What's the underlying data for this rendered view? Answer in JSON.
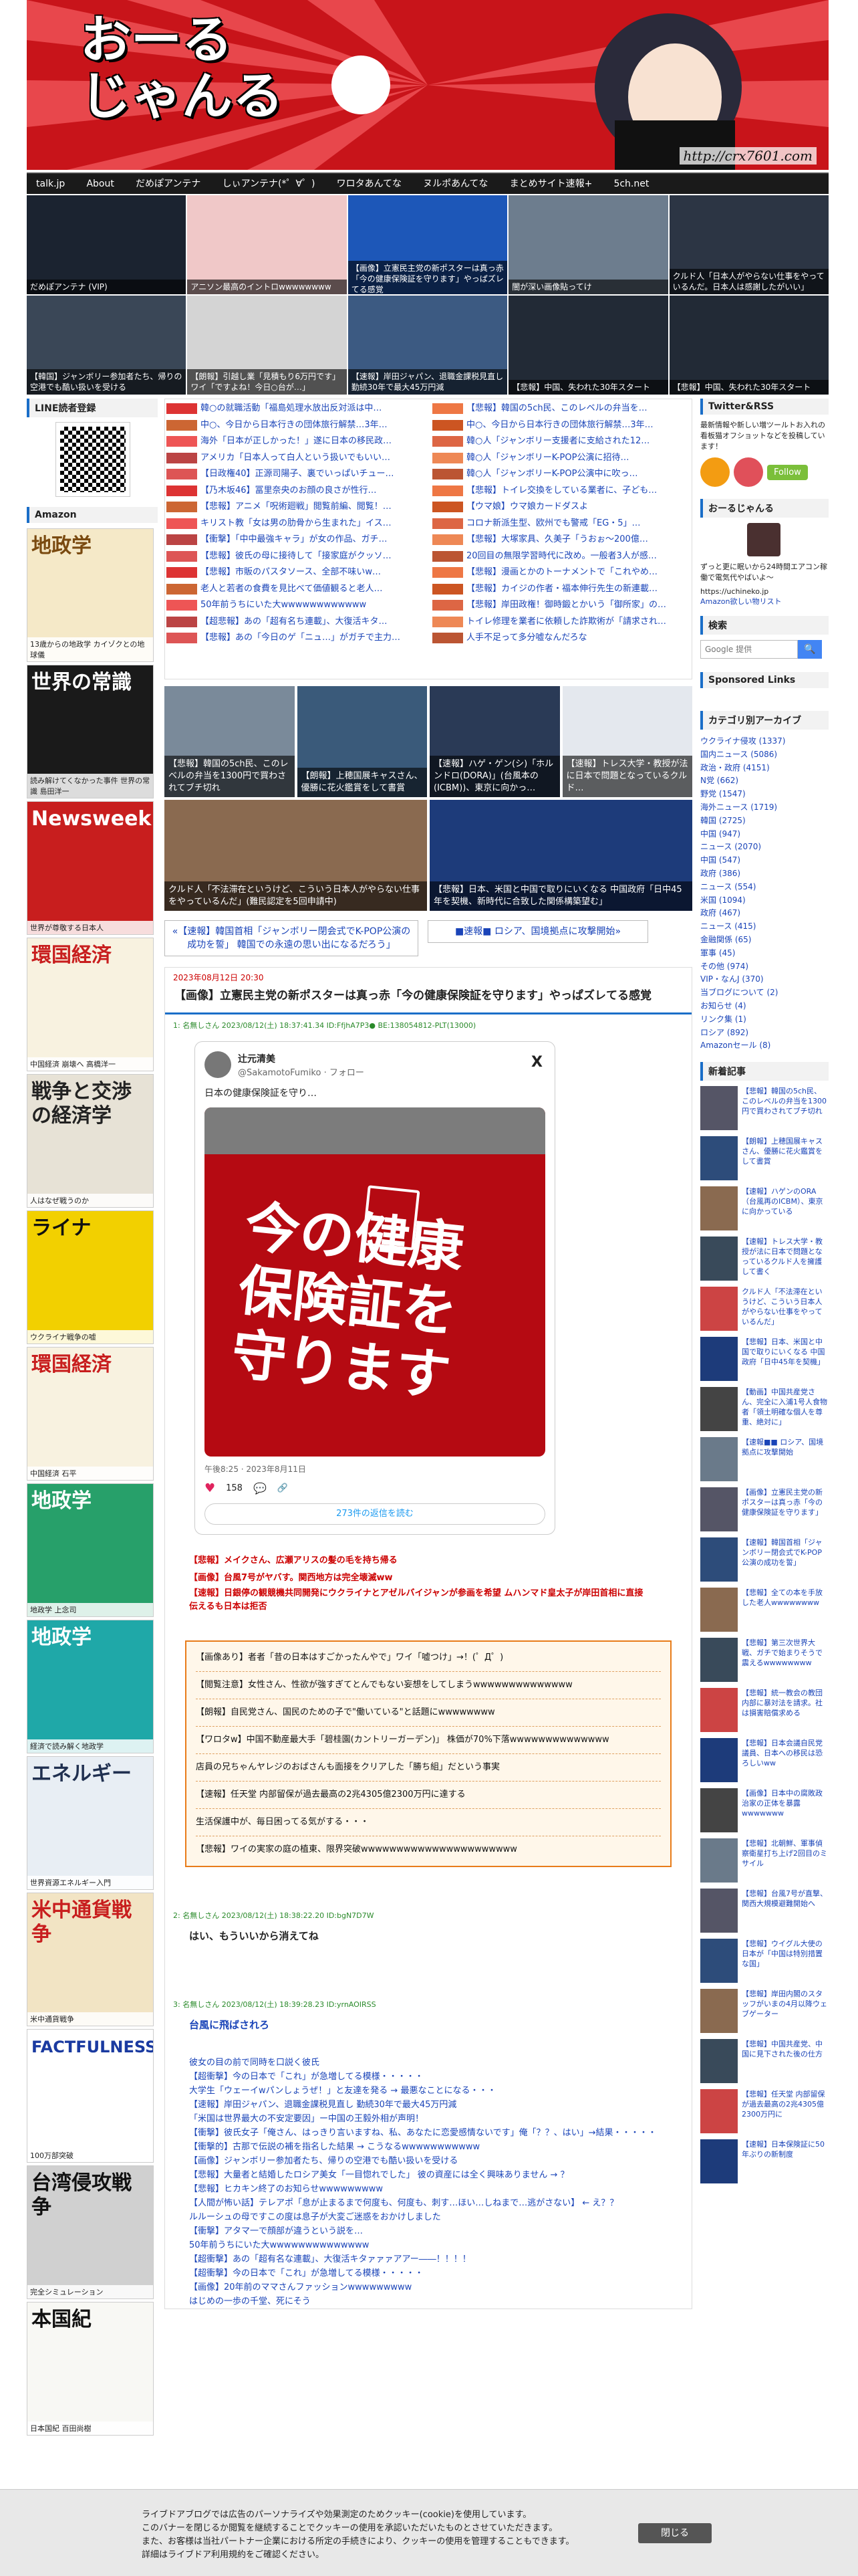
{
  "site": {
    "logo_lines": [
      "おーる",
      "じゃんる"
    ],
    "url": "http://crx7601.com",
    "marker": "0"
  },
  "nav": [
    "talk.jp",
    "About",
    "だめぽアンテナ",
    "しぃアンテナ(*゜∀゜)",
    "ワロタあんてな",
    "ヌルポあんてな",
    "まとめサイト速報+",
    "5ch.net"
  ],
  "strip": [
    "だめぽアンテナ (VIP)",
    "アニソン最高のイントロwwwwwwww",
    "【画像】立憲民主党の新ポスターは真っ赤「今の健康保険証を守ります」やっぱズレてる感覚",
    "闇が深い画像貼ってけ",
    "クルド人「日本人がやらない仕事をやっているんだ。日本人は感謝したがいい」",
    "【韓国】ジャンボリー参加者たち、帰りの空港でも酷い扱いを受ける",
    "【朗報】引越し業「見積もり6万円です」ワイ「ですよね！今日○台が…」",
    "【速報】岸田ジャパン、退職金課税見直し 勤続30年で最大45万円減",
    "【悲報】中国、失われた30年スタート",
    "【悲報】中国、失われた30年スタート"
  ],
  "left": {
    "line_heading": "LINE読者登録",
    "amazon_heading": "Amazon",
    "books": [
      {
        "title": "地政学",
        "caption": "13歳からの地政学 カイゾクとの地球儀"
      },
      {
        "title": "世界の常識",
        "caption": "読み解けてくなかった事件 世界の常識 島田洋一"
      },
      {
        "title": "Newsweek",
        "caption": "世界が尊敬する日本人"
      },
      {
        "title": "環国経済",
        "caption": "中国経済 崩壊へ 高橋洋一"
      },
      {
        "title": "戦争と交渉の経済学",
        "caption": "人はなぜ戦うのか"
      },
      {
        "title": "ライナ",
        "caption": "ウクライナ戦争の嘘"
      },
      {
        "title": "環国経済",
        "caption": "中国経済 石平"
      },
      {
        "title": "地政学",
        "caption": "地政学 上念司"
      },
      {
        "title": "地政学",
        "caption": "経済で読み解く地政学"
      },
      {
        "title": "エネルギー",
        "caption": "世界資源エネルギー入門"
      },
      {
        "title": "米中通貨戦争",
        "caption": "米中通貨戦争"
      },
      {
        "title": "FACTFULNESS",
        "caption": "100万部突破"
      },
      {
        "title": "台湾侵攻戦争",
        "caption": "完全シミュレーション"
      },
      {
        "title": "本国紀",
        "caption": "日本国紀 百田尚樹"
      }
    ]
  },
  "headlines": {
    "left": [
      "韓○の就職活動「福島処理水放出反対派は中…",
      "中○、今日から日本行きの団体旅行解禁…3年…",
      "海外「日本が正しかった！」遂に日本の移民政…",
      "アメリカ「日本人って白人という扱いでもいい…",
      "【日政権40】正源司陽子、裏でいっぱいチュー…",
      "【乃木坂46】冨里奈央のお顔の良さが性行…",
      "【悲報】アニメ「呪術廻戦」閲覧前編、閲覧！…",
      "キリスト教「女は男の肋骨から生まれた」イス…",
      "【衝撃】「中中最強キャラ」が女の作品、ガチ…",
      "【悲報】彼氏の母に接待して「接家庭がクッソ…",
      "【悲報】市販のパスタソース、全部不味いw…",
      "老人と若者の食費を見比べて価値観ると老人…",
      "50年前うちにいた大wwwwwwwwwwww",
      "【超悲報】あの「超有名ち連載」、大復活キタ…",
      "【悲報】あの「今日のゲ「ニュ…」がガチで主力…"
    ],
    "right": [
      "【悲報】韓国の5ch民、このレベルの弁当を…",
      "中○、今日から日本行きの団体旅行解禁…3年…",
      "韓○人「ジャンボリー支援者に支給された12…",
      "韓○人「ジャンボリーK-POP公演に招待…",
      "韓○人「ジャンボリーK-POP公演中に吹っ…",
      "【悲報】トイレ交換をしている業者に、子ども…",
      "【ウマ娘】ウマ娘カードダスよ",
      "コロナ新派生型、欧州でも警戒「EG・5」…",
      "【悲報】大塚家具、久美子「うおぉ～200億…",
      "20回目の無限学習時代に改め。一般者3人が感…",
      "【悲報】漫画とかのトーナメントで「これやめ…",
      "【悲報】カイジの作者・福本伸行先生の新連載…",
      "【悲報】岸田政権！御時鍛とかいう「御所家」の…",
      "トイレ修理を業者に依頼した詐欺術が「請求され…",
      "人手不足って多分嘘なんだろな"
    ]
  },
  "featured": [
    "【悲報】韓国の5ch民、このレベルの弁当を1300円で買わされてブチ切れ",
    "【朗報】上穂国展キャスさん、優勝に花火鑑賞をして書賞",
    "【速報】ハゲ・ゲン(シ)「ホルンドロ(DORA)」(台風本の(ICBM))、東京に向かっ…",
    "【速報】トレス大学・教授が法に日本で問題となっているクルド…",
    "クルド人「不法滞在というけど、こういう日本人がやらない仕事をやっているんだ」(難民認定を5回申請中)",
    "【悲報】日本、米国と中国で取りにいくなる 中国政府「日中45年を契機、新時代に合致した関係構築望む」"
  ],
  "prev_next": {
    "prev": "«【速報】韓国首相「ジャンボリー閉会式でK-POP公演の成功を誓」 韓国での永遠の思い出になるだろう」",
    "next": "■速報■ ロシア、国境拠点に攻撃開始»"
  },
  "article": {
    "date": "2023年08月12日 20:30",
    "title": "【画像】立憲民主党の新ポスターは真っ赤「今の健康保険証を守ります」やっぱズレてる感覚",
    "res1_head": "1: 名無しさん 2023/08/12(土) 18:37:41.34 ID:FfjhA7P3●  BE:138054812-PLT(13000)",
    "tweet": {
      "name": "辻元清美",
      "handle": "@SakamotoFumiko · フォロー",
      "text": "日本の健康保険証を守り…",
      "poster": "今の健康保険証を守ります",
      "date": "午後8:25 · 2023年8月11日",
      "likes": "158",
      "replies": "273件の返信を読む",
      "x_logo": "X"
    },
    "red_links": [
      "【悲報】メイクさん、広瀬アリスの髪の毛を持ち帰る",
      "【画像】台風7号がヤバす。関西地方は完全壊滅ww",
      "【速報】日銀停の観競機共同開発にウクライナとアゼルバイジャンが参画を希望 ムハンマド皇太子が岸田首相に直接伝えるも日本は拒否"
    ],
    "box": [
      "【画像あり】者者「昔の日本はすごかったんやで」ワイ「嘘つけ」→！(゜Д゜)",
      "【閲覧注意】女性さん、性欲が強すぎてとんでもない妄想をしてしまうwwwwwwwwwwwwww",
      "【朗報】自民党さん、国民のための子で\"働いている\"と話題にwwwwwwww",
      "【ワロタw】中国不動産最大手「碧桂園(カントリーガーデン)」 株価が70%下落wwwwwwwwwwwwww",
      "店員の兄ちゃんヤレジのおばさんも面接をクリアした「勝ち組」だという事実",
      "【速報】任天堂 内部留保が過去最高の2兆4305億2300万円に達する",
      "生活保護中が、毎日困ってる気がする・・・",
      "【悲報】ワイの実家の庭の植東、限界突破wwwwwwwwwwwwwwwwwwwwww"
    ],
    "res2_head": "2: 名無しさん 2023/08/12(土) 18:38:22.20 ID:bgN7D7W",
    "res2": "はい、もういいから消えてね",
    "res3_head": "3: 名無しさん 2023/08/12(土) 18:39:28.23 ID:yrnAOIRSS",
    "res3": "台風に飛ばされろ",
    "body_links": [
      "彼女の目の前で同時を口説く彼氏",
      "【超衝撃】今の日本で「これ」が急増してる模様・・・・・",
      "大学生「ウェーイwパンしょうぜ！」と友達を発る → 最悪なことになる・・・",
      "【速報】岸田ジャパン、退職金課税見直し 勤続30年で最大45万円減",
      "「米国は世界最大の不安定要因」ー中国の王毅外相が声明！",
      "【衝撃】彼氏女子「俺さん、はっきり言いますね、私、あなたに恋愛感情ないです」俺「？？、はい」→結果・・・・・",
      "【衝撃的】古那で伝説の補を指名した結果 → こうなるwwwwwwwwwww",
      "【画像】ジャンボリー参加者たち、帰りの空港でも酷い扱いを受ける",
      "【悲報】大量者と結婚したロシア美女「一目惚れでした」 彼の資産には全く興味ありません → ？",
      "【悲報】ヒカキン終了のお知らせwwwwwwwww",
      "【人間が怖い話】テレアポ「息が止まるまで何度も、何度も、刺す…ほい…しねまで…逃がさない】 ← え？？",
      "ルルーシュの母ですこの度は息子が大変ご迷惑をおかけしました",
      "【衝撃】アタマ一で顔部が違うという説を…",
      "50年前うちにいた大wwwwwwwwwwwwww",
      "【超衝撃】あの「超有名な連載」、大復活キタァァァアアー――！！！！",
      "【超衝撃】今の日本で「これ」が急増してる模様・・・・・",
      "【画像】20年前のママさんファッションwwwwwwwww",
      "はじめの一歩の千堂、死にそう"
    ]
  },
  "right": {
    "twitter_heading": "Twitter&RSS",
    "twitter_text": "最新情報や新しい増ツールトお入れの看板猫オフショットなどを投稿しています！",
    "follow": "Follow",
    "about_heading": "おーるじゃんる",
    "about_text": "ずっと更に眠いから24時間エアコン稼働で電気代やばいよ～",
    "about_url": "https://uchineko.jp",
    "amazon_link": "Amazon欲しい物リスト",
    "search_heading": "検索",
    "search_placeholder": "Google 提供",
    "sponsored": "Sponsored Links",
    "category_heading": "カテゴリ別アーカイブ",
    "categories": [
      "ウクライナ侵攻 (1337)",
      "国内ニュース (5086)",
      "政治・政府 (4151)",
      "N党 (662)",
      "野党 (1547)",
      "海外ニュース (1719)",
      "韓国 (2725)",
      "中国 (947)",
      "ニュース (2070)",
      "中国 (547)",
      "政府 (386)",
      "ニュース (554)",
      "米国 (1094)",
      "政府 (467)",
      "ニュース (415)",
      "金融関係 (65)",
      "軍事 (45)",
      "その他 (974)",
      "VIP・なんJ (370)",
      "当ブログについて (2)",
      "お知らせ (4)",
      "リンク集 (1)",
      "ロシア (892)",
      "Amazonセール (8)"
    ],
    "new_heading": "新着記事",
    "new_articles": [
      "【悲報】韓国の5ch民、このレベルの弁当を1300円で買わされてブチ切れ",
      "【朗報】上穂国展キャスさん、優勝に花火鑑賞をして書賞",
      "【速報】ハゲンのORA（台風再のICBM）、東京に向かっている",
      "【速報】トレス大学・教授が法に日本で問題となっているクルド人を擁護して書く",
      "クルド人「不法滞在というけど、こういう日本人がやらない仕事をやっているんだ」",
      "【悲報】日本、米国と中国で取りにいくなる 中国政府「日中45年を契機」",
      "【動画】中国共産党さん、完全に入浦1号人食物者「領土明確な個人を尊重、絶対に」",
      "【速報■■ ロシア、国境拠点に攻撃開始",
      "【画像】立憲民主党の新ポスターは真っ赤「今の健康保険証を守ります」",
      "【速報】韓国首相「ジャンボリー閉会式でK-POP公演の成功を誓」",
      "【悲報】全ての本を手放した老人wwwwwwww",
      "【悲報】第三次世界大戦、ガチで始まりそうで震えるwwwwwwww",
      "【悲報】統一教会の教団内部に暴対法を請求。社は損害賠償求める",
      "【悲報】日本会議自民党議員、日本への移民は恐ろしいww",
      "【画像】日本中の腐敗政治家の正体を暴露wwwwwww",
      "【悲報】北朝鮮、軍事偵察衛星打ち上げ2回目のミサイル",
      "【悲報】台風7号が直撃、関西大規模避難開始へ",
      "【悲報】ウイグル大使の日本が「中国は特別措置な国」",
      "【悲報】岸田内閣のスタッフがいまの4月以降ウェブゲーター",
      "【悲報】中国共産党、中国に見下された後の仕方",
      "【悲報】任天堂 内部留保が過去最高の2兆4305億2300万円に",
      "【速報】日本保険証に50年ぶりの新制度"
    ]
  },
  "cookie": {
    "lines": [
      "ライブドアブログでは広告のパーソナライズや効果測定のためクッキー(cookie)を使用しています。",
      "このバナーを閉じるか閲覧を継続することでクッキーの使用を承認いただいたものとさせていただきます。",
      "また、お客様は当社パートナー企業における所定の手続きにより、クッキーの使用を管理することもできます。",
      "詳細はライブドア利用規約をご確認ください。"
    ],
    "close": "閉じる"
  },
  "colors": {
    "banner": "#c8141a",
    "accent": "#1a6ec8",
    "link": "#1a44b8"
  }
}
